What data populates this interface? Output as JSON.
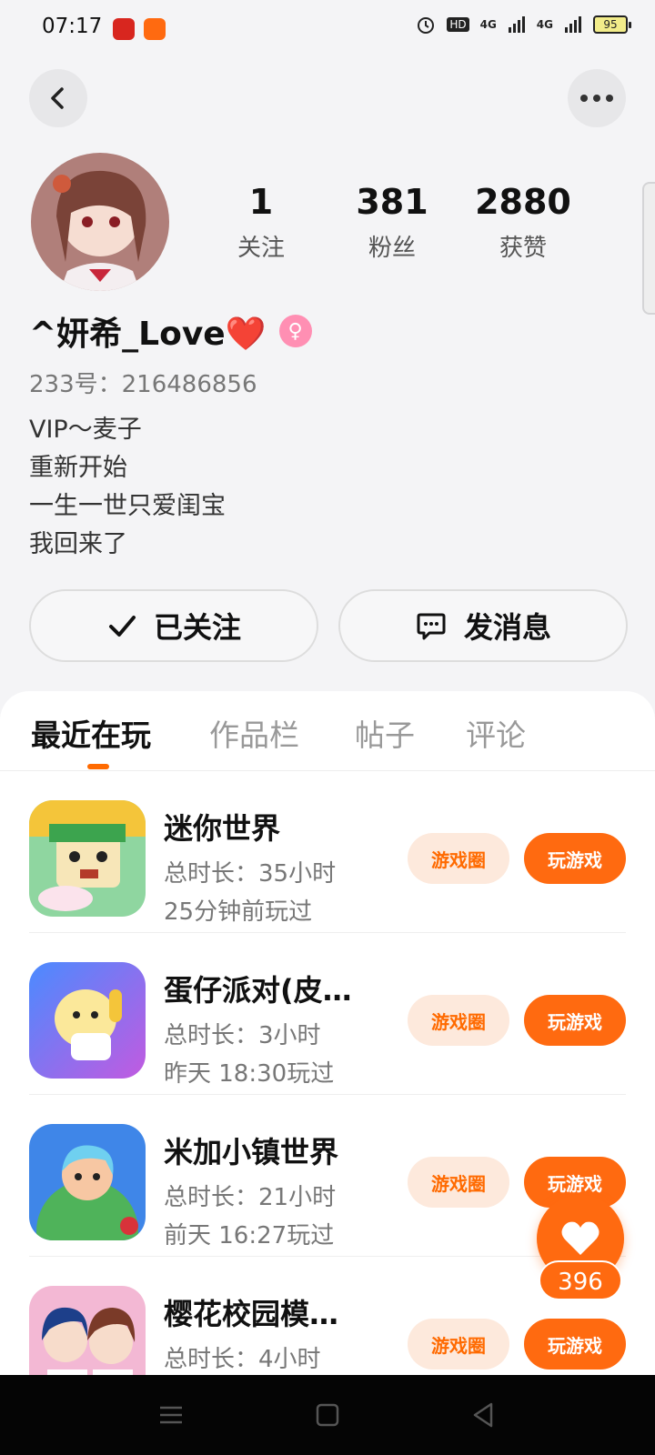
{
  "status_bar": {
    "time": "07:17",
    "battery": "95",
    "network1": "4G",
    "network2": "4G",
    "hd": "HD"
  },
  "profile": {
    "name": "^妍希_Love❤️",
    "gender_symbol": "♀",
    "uid": "233号：216486856",
    "bio": [
      "VIP～麦子",
      "重新开始",
      "一生一世只爱闺宝",
      "我回来了"
    ],
    "stats": [
      {
        "value": "1",
        "label": "关注"
      },
      {
        "value": "381",
        "label": "粉丝"
      },
      {
        "value": "2880",
        "label": "获赞"
      }
    ]
  },
  "actions": {
    "follow_label": "已关注",
    "message_label": "发消息"
  },
  "tabs": [
    {
      "label": "最近在玩",
      "active": true
    },
    {
      "label": "作品栏",
      "active": false
    },
    {
      "label": "帖子",
      "active": false
    },
    {
      "label": "评论",
      "active": false
    }
  ],
  "games": [
    {
      "name": "迷你世界",
      "duration": "总时长：35小时",
      "last_played": "25分钟前玩过",
      "circle_label": "游戏圈",
      "play_label": "玩游戏",
      "icon_color": "#3cb35a"
    },
    {
      "name": "蛋仔派对(皮…",
      "duration": "总时长：3小时",
      "last_played": "昨天 18:30玩过",
      "circle_label": "游戏圈",
      "play_label": "玩游戏",
      "icon_color": "#4a7dff"
    },
    {
      "name": "米加小镇世界",
      "duration": "总时长：21小时",
      "last_played": "前天 16:27玩过",
      "circle_label": "游戏圈",
      "play_label": "玩游戏",
      "icon_color": "#3c8ef0"
    },
    {
      "name": "樱花校园模…",
      "duration": "总时长：4小时",
      "last_played": "",
      "circle_label": "游戏圈",
      "play_label": "玩游戏",
      "icon_color": "#e0508a"
    }
  ],
  "like_fab": {
    "count": "396"
  },
  "colors": {
    "accent": "#ff6a10",
    "accent_light": "#fde9dc",
    "background": "#f4f4f6"
  }
}
